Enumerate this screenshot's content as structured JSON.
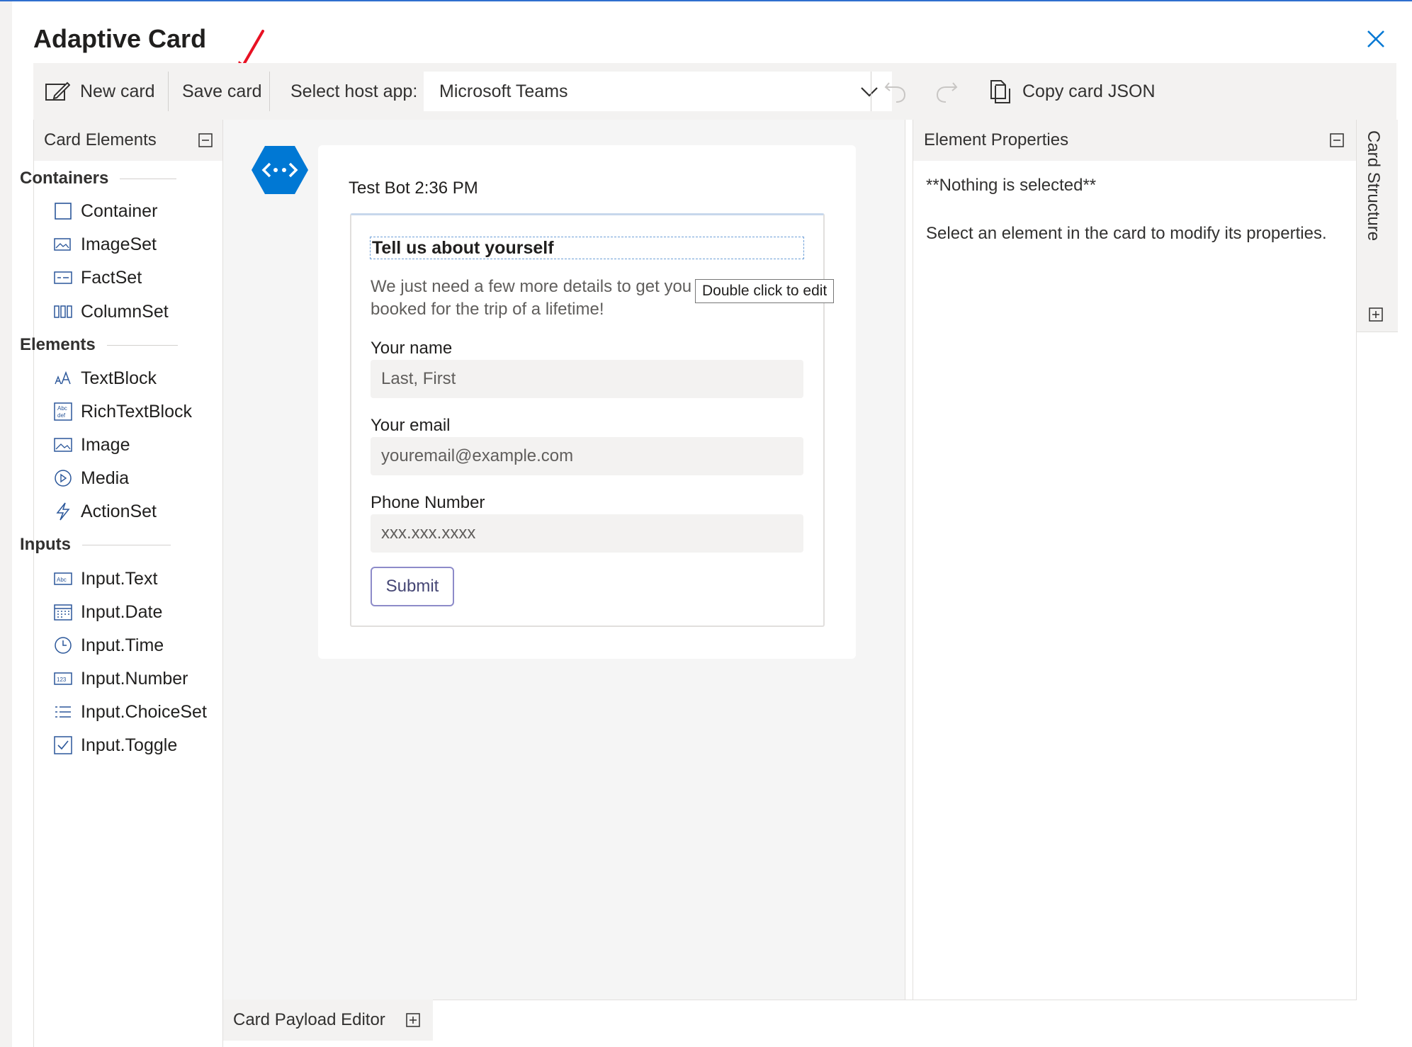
{
  "window": {
    "title": "Adaptive Card"
  },
  "toolbar": {
    "new_card": "New card",
    "save_card": "Save card",
    "host_label": "Select host app:",
    "host_value": "Microsoft Teams",
    "copy_json": "Copy card JSON"
  },
  "card_elements": {
    "header": "Card Elements",
    "groups": [
      {
        "title": "Containers",
        "items": [
          {
            "label": "Container",
            "icon": "container-icon"
          },
          {
            "label": "ImageSet",
            "icon": "imageset-icon"
          },
          {
            "label": "FactSet",
            "icon": "factset-icon"
          },
          {
            "label": "ColumnSet",
            "icon": "columnset-icon"
          }
        ]
      },
      {
        "title": "Elements",
        "items": [
          {
            "label": "TextBlock",
            "icon": "textblock-icon"
          },
          {
            "label": "RichTextBlock",
            "icon": "richtextblock-icon"
          },
          {
            "label": "Image",
            "icon": "image-icon"
          },
          {
            "label": "Media",
            "icon": "media-icon"
          },
          {
            "label": "ActionSet",
            "icon": "actionset-icon"
          }
        ]
      },
      {
        "title": "Inputs",
        "items": [
          {
            "label": "Input.Text",
            "icon": "input-text-icon"
          },
          {
            "label": "Input.Date",
            "icon": "input-date-icon"
          },
          {
            "label": "Input.Time",
            "icon": "input-time-icon"
          },
          {
            "label": "Input.Number",
            "icon": "input-number-icon"
          },
          {
            "label": "Input.ChoiceSet",
            "icon": "input-choiceset-icon"
          },
          {
            "label": "Input.Toggle",
            "icon": "input-toggle-icon"
          }
        ]
      }
    ]
  },
  "preview": {
    "bot_line": "Test Bot 2:36 PM",
    "card": {
      "title": "Tell us about yourself",
      "subtitle": "We just need a few more details to get you booked for the trip of a lifetime!",
      "tooltip": "Double click to edit",
      "fields": [
        {
          "label": "Your name",
          "placeholder": "Last, First"
        },
        {
          "label": "Your email",
          "placeholder": "youremail@example.com"
        },
        {
          "label": "Phone Number",
          "placeholder": "xxx.xxx.xxxx"
        }
      ],
      "submit": "Submit"
    }
  },
  "properties": {
    "header": "Element Properties",
    "nothing_selected": "**Nothing is selected**",
    "hint": "Select an element in the card to modify its properties."
  },
  "structure": {
    "label": "Card Structure"
  },
  "payload": {
    "label": "Card Payload Editor"
  },
  "colors": {
    "accent": "#0078d4",
    "submit_border": "#8d8bc9",
    "annotation": "#e81123"
  }
}
